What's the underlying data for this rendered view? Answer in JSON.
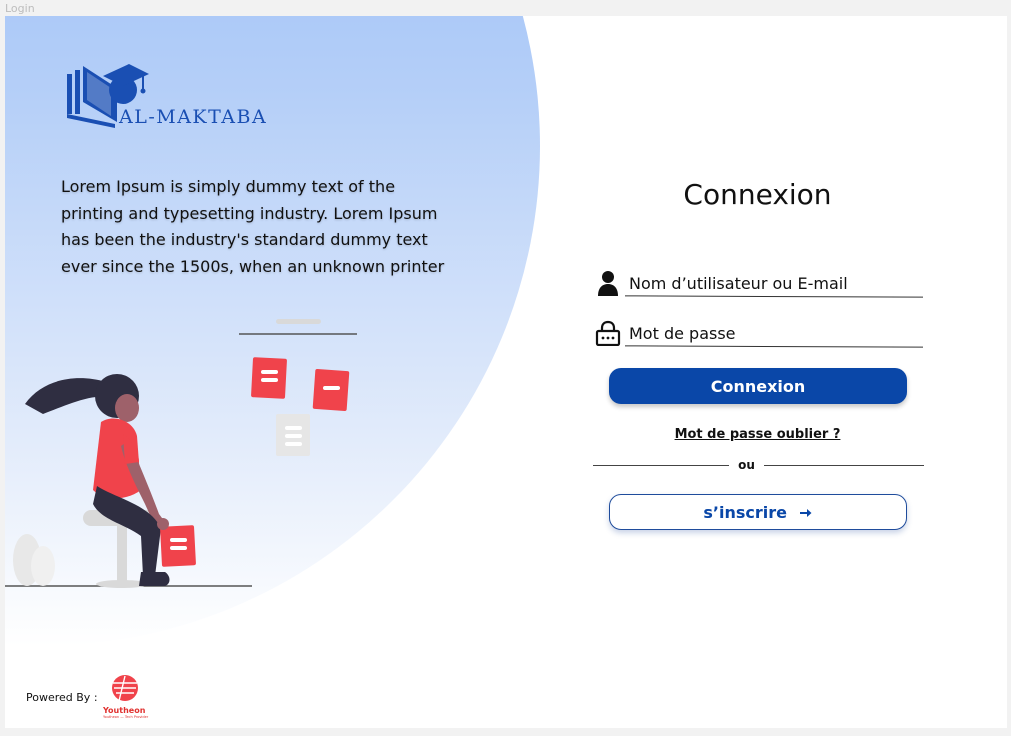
{
  "frame": {
    "label": "Login"
  },
  "brand": {
    "name": "AL-MAKTABA"
  },
  "hero": {
    "text": "Lorem Ipsum is simply dummy text of the printing and typesetting industry. Lorem Ipsum has been the industry's standard dummy text ever since the 1500s, when an unknown printer"
  },
  "login": {
    "title": "Connexion",
    "username_placeholder": "Nom d’utilisateur ou E-mail",
    "password_placeholder": "Mot de passe",
    "submit_label": "Connexion",
    "forgot_label": "Mot de passe oublier ?",
    "or_label": "ou",
    "signup_label": "s’inscrire"
  },
  "footer": {
    "powered_by": "Powered By :",
    "company": "Youtheon",
    "company_tagline": "Youtheon — Tech Provider"
  },
  "colors": {
    "primary": "#0a47a8",
    "gradient_top": "#89b4f7",
    "accent_red": "#f0434b",
    "brand_blue": "#1a4fb3"
  }
}
